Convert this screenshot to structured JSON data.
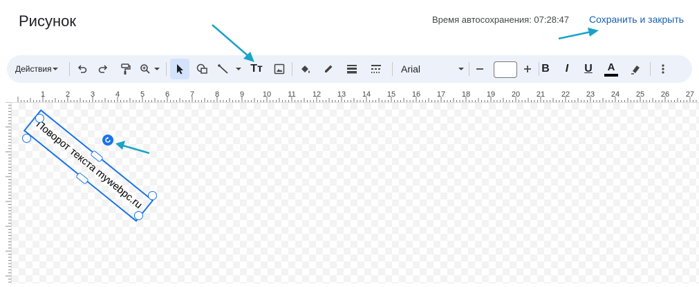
{
  "header": {
    "title": "Рисунок",
    "autosave": "Время автосохранения: 07:28:47",
    "save_close": "Сохранить и закрыть"
  },
  "toolbar": {
    "actions_label": "Действия",
    "font_name": "Arial",
    "font_size": "",
    "bold": "B",
    "italic": "I",
    "underline": "U",
    "text_color": "A",
    "textbox_icon": "Tт"
  },
  "ruler": {
    "numbers": [
      "1",
      "2",
      "3",
      "4",
      "5",
      "6",
      "7",
      "8",
      "9",
      "10",
      "11",
      "12",
      "13",
      "14",
      "15",
      "16",
      "17",
      "18",
      "19",
      "20",
      "21",
      "22",
      "23",
      "24",
      "25",
      "26",
      "27"
    ]
  },
  "drawing": {
    "textbox_text": "Поворот текста mywebpc.ru",
    "accent": "#1a73e8",
    "annotation_arrow_color": "#1aa3c7"
  }
}
